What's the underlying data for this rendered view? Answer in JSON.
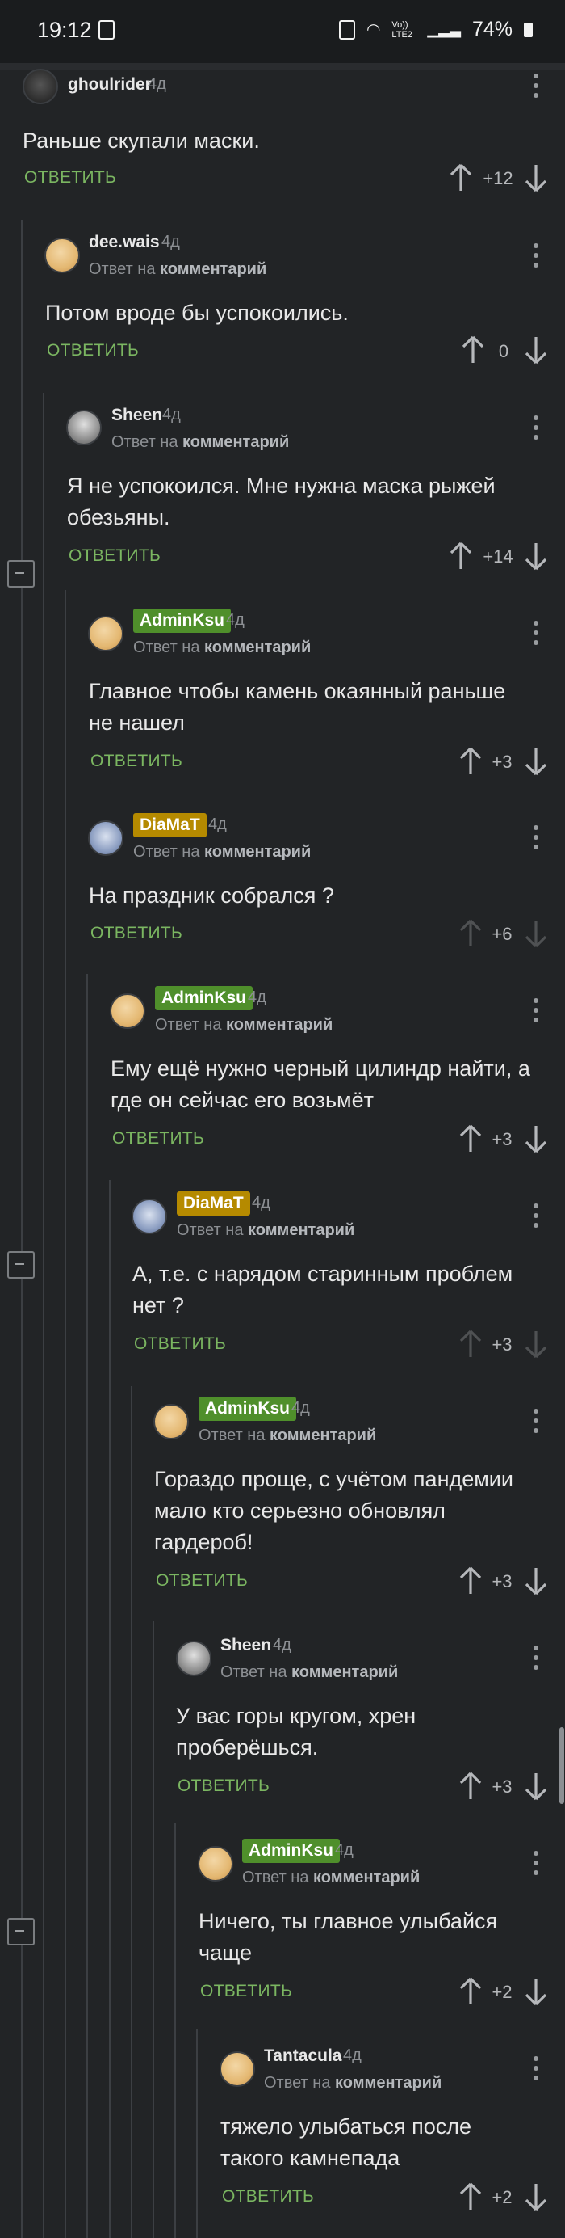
{
  "status": {
    "time": "19:12",
    "network": "Vo)) LTE2",
    "battery": "74%"
  },
  "comments": [
    {
      "author": "ghoulrider",
      "time": "4д",
      "text": "Раньше скупали маски.",
      "answer": "ОТВЕТИТЬ",
      "rating": "+12"
    },
    {
      "author": "dee.wais",
      "time": "4д",
      "reply_prefix": "Ответ на",
      "reply_target": "комментарий",
      "text": "Потом вроде бы успокоились.",
      "answer": "ОТВЕТИТЬ",
      "rating": "0"
    },
    {
      "author": "Sheen",
      "time": "4д",
      "reply_prefix": "Ответ на",
      "reply_target": "комментарий",
      "text1": "Я не успокоился. Мне нужна маска рыжей",
      "text2": "обезьяны.",
      "answer": "ОТВЕТИТЬ",
      "rating": "+14"
    },
    {
      "author": "AdminKsu",
      "time": "4д",
      "reply_prefix": "Ответ на",
      "reply_target": "комментарий",
      "text1": "Главное чтобы камень окаянный раньше",
      "text2": "не нашел",
      "answer": "ОТВЕТИТЬ",
      "rating": "+3"
    },
    {
      "author": "DiaMaT",
      "time": "4д",
      "reply_prefix": "Ответ на",
      "reply_target": "комментарий",
      "text": "На праздник собрался ?",
      "answer": "ОТВЕТИТЬ",
      "rating": "+6"
    },
    {
      "author": "AdminKsu",
      "time": "4д",
      "reply_prefix": "Ответ на",
      "reply_target": "комментарий",
      "text1": "Ему ещё нужно черный цилиндр найти, а",
      "text2": "где он сейчас его возьмёт",
      "answer": "ОТВЕТИТЬ",
      "rating": "+3"
    },
    {
      "author": "DiaMaT",
      "time": "4д",
      "reply_prefix": "Ответ на",
      "reply_target": "комментарий",
      "text1": "А, т.е. с нарядом старинным проблем",
      "text2": "нет ?",
      "answer": "ОТВЕТИТЬ",
      "rating": "+3"
    },
    {
      "author": "AdminKsu",
      "time": "4д",
      "reply_prefix": "Ответ на",
      "reply_target": "комментарий",
      "text1": "Гораздо проще, с учётом пандемии",
      "text2": "мало кто серьезно обновлял",
      "text3": "гардероб!",
      "answer": "ОТВЕТИТЬ",
      "rating": "+3"
    },
    {
      "author": "Sheen",
      "time": "4д",
      "reply_prefix": "Ответ на",
      "reply_target": "комментарий",
      "text1": "У вас горы кругом, хрен",
      "text2": "проберёшься.",
      "answer": "ОТВЕТИТЬ",
      "rating": "+3"
    },
    {
      "author": "AdminKsu",
      "time": "4д",
      "reply_prefix": "Ответ на",
      "reply_target": "комментарий",
      "text1": "Ничего, ты главное улыбайся",
      "text2": "чаще",
      "answer": "ОТВЕТИТЬ",
      "rating": "+2"
    },
    {
      "author": "Tantacula",
      "time": "4д",
      "reply_prefix": "Ответ на",
      "reply_target": "комментарий",
      "text1": "тяжело улыбаться после",
      "text2": "такого камнепада",
      "answer": "ОТВЕТИТЬ",
      "rating": "+2"
    }
  ],
  "colors": {
    "background": "#222426",
    "answer": "#7bb661",
    "admin_badge": "#4f8f2b",
    "gold_badge": "#b58a00"
  },
  "icons": [
    "upvote-icon",
    "downvote-icon",
    "more-vertical-icon",
    "collapse-icon"
  ]
}
